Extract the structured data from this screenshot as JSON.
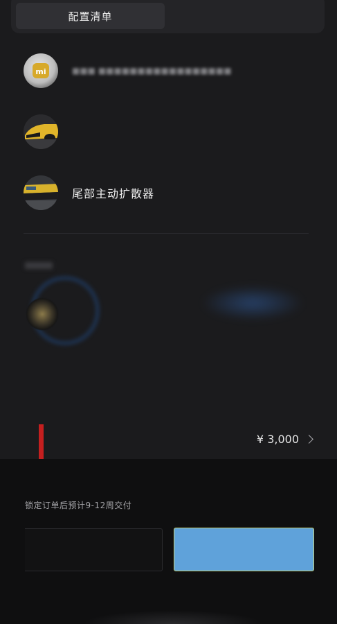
{
  "tabs": {
    "active_label": "配置清单"
  },
  "items": [
    {
      "label": "",
      "icon": "mi-logo-icon"
    },
    {
      "label": "",
      "icon": "car-front-yellow-icon"
    },
    {
      "label": "尾部主动扩散器",
      "icon": "car-rear-diffuser-icon"
    }
  ],
  "wheel_section": {
    "icon": "wheel-icon"
  },
  "price": {
    "amount": "¥ 3,000",
    "accent_color": "#c51f1f"
  },
  "footer": {
    "delivery_note": "锁定订单后预计9-12周交付",
    "secondary_button_label": "",
    "primary_button_label": "",
    "primary_color": "#5fa2da"
  }
}
